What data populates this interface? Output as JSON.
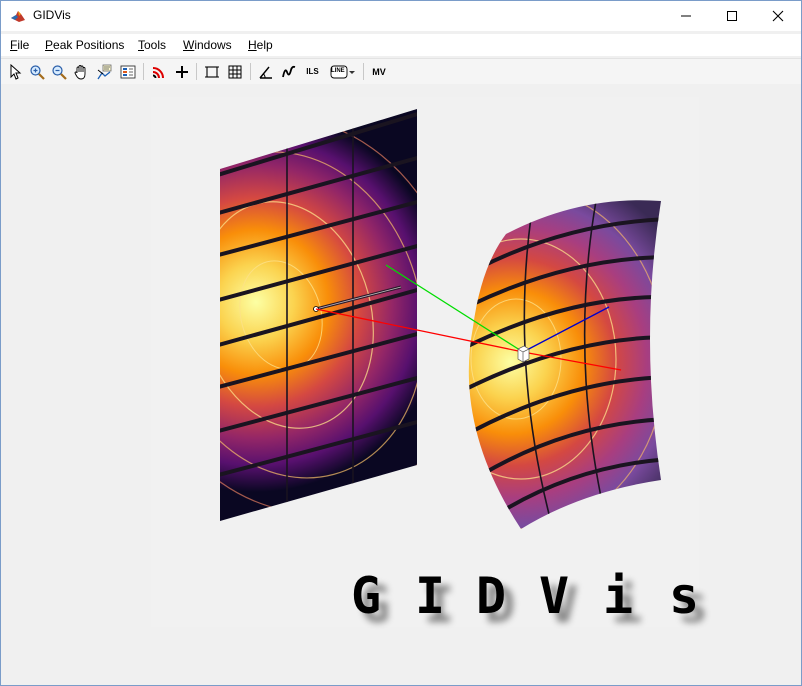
{
  "window": {
    "title": "GIDVis",
    "controls": {
      "minimize": "minimize",
      "maximize": "maximize",
      "close": "close"
    }
  },
  "menu": [
    {
      "label": "File",
      "mnemonic": "F",
      "rest": "ile"
    },
    {
      "label": "Peak Positions",
      "mnemonic": "P",
      "rest": "eak Positions"
    },
    {
      "label": "Tools",
      "mnemonic": "T",
      "rest": "ools"
    },
    {
      "label": "Windows",
      "mnemonic": "W",
      "rest": "indows"
    },
    {
      "label": "Help",
      "mnemonic": "H",
      "rest": "elp"
    }
  ],
  "toolbar": {
    "items": [
      {
        "name": "select-arrow-icon"
      },
      {
        "name": "zoom-in-icon"
      },
      {
        "name": "zoom-out-icon"
      },
      {
        "name": "pan-hand-icon"
      },
      {
        "name": "data-cursor-icon"
      },
      {
        "name": "colorbar-icon"
      },
      {
        "name": "ring-overlay-icon"
      },
      {
        "name": "crosshair-plus-icon"
      },
      {
        "name": "box-select-icon"
      },
      {
        "name": "grid-icon"
      },
      {
        "name": "angle-measure-icon"
      },
      {
        "name": "line-profile-icon"
      },
      {
        "name": "ils-button",
        "text": "ILS"
      },
      {
        "name": "line-dropdown-button",
        "text": "LINE"
      },
      {
        "name": "mv-button",
        "text": "MV"
      }
    ]
  },
  "logo": {
    "letters": [
      "G",
      "I",
      "D",
      "V",
      "i",
      "s"
    ]
  },
  "colors": {
    "axis_x": "#ff0000",
    "axis_y": "#00dd00",
    "axis_z": "#0000cc",
    "colormap_high": "#fcffa4",
    "colormap_mid": "#f98e09",
    "colormap_low": "#57106e",
    "colormap_min": "#000004"
  }
}
